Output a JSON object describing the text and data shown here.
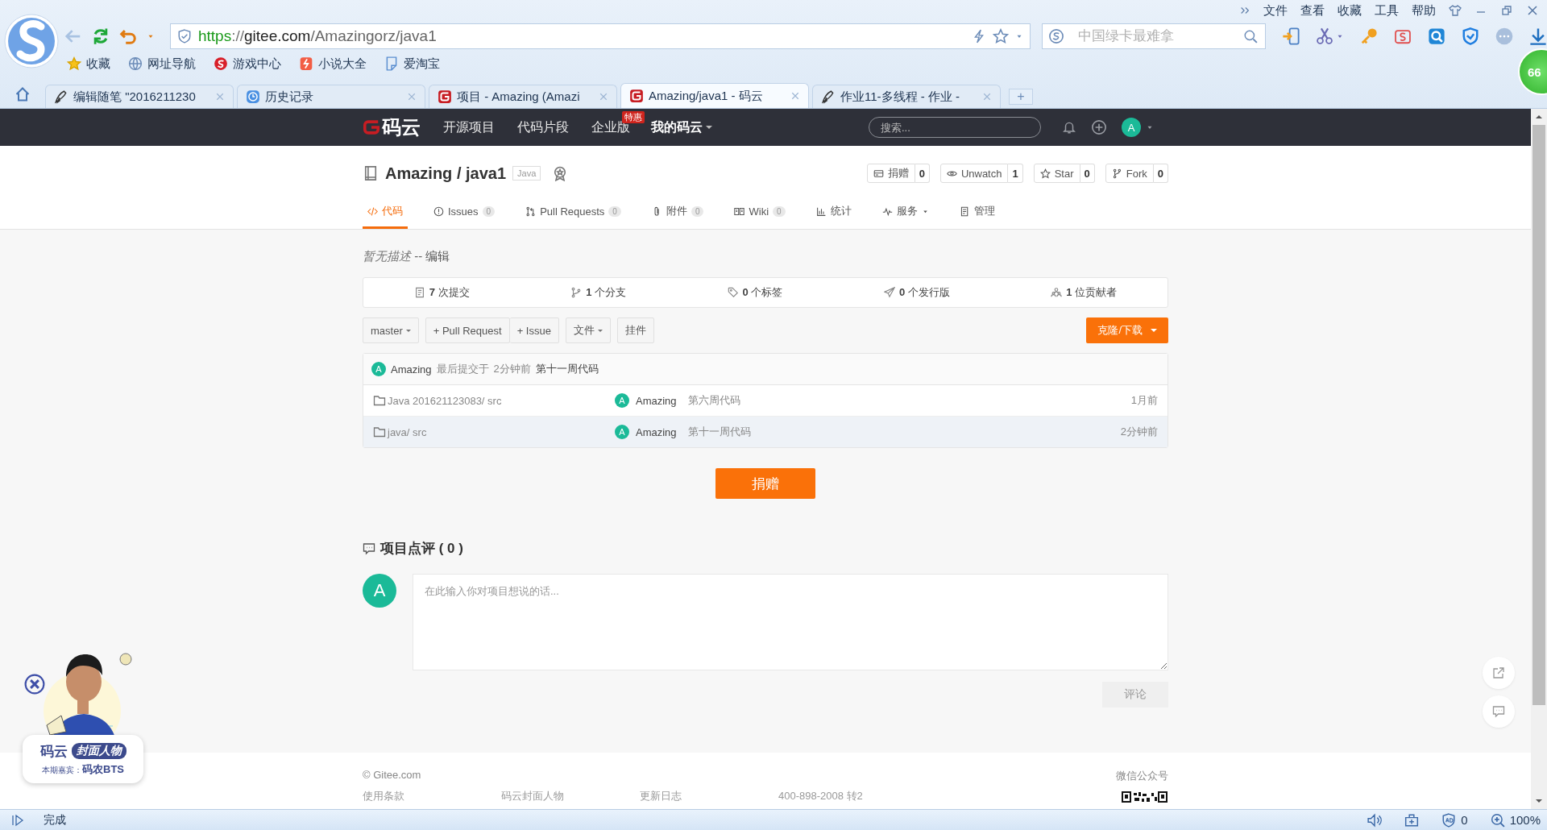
{
  "browser": {
    "menu": [
      "文件",
      "查看",
      "收藏",
      "工具",
      "帮助"
    ],
    "address": [
      {
        "kind": "scheme",
        "text": "https"
      },
      {
        "kind": "punct",
        "text": "://"
      },
      {
        "kind": "host",
        "text": "gitee.com"
      },
      {
        "kind": "path",
        "text": "/Amazingorz/java1"
      }
    ],
    "search": {
      "placeholder": "中国绿卡最难拿"
    },
    "bookmarks": [
      {
        "label": "收藏",
        "kind": "star"
      },
      {
        "label": "网址导航",
        "kind": "globe"
      },
      {
        "label": "游戏中心",
        "kind": "game"
      },
      {
        "label": "小说大全",
        "kind": "novel"
      },
      {
        "label": "爱淘宝",
        "kind": "page"
      }
    ],
    "tabs": [
      {
        "title": "编辑随笔 \"2016211230",
        "kind": "pen",
        "selected": false
      },
      {
        "title": "历史记录",
        "kind": "clock",
        "selected": false
      },
      {
        "title": "项目 - Amazing (Amazi",
        "kind": "gitee",
        "selected": false
      },
      {
        "title": "Amazing/java1 - 码云",
        "kind": "gitee",
        "selected": true
      },
      {
        "title": "作业11-多线程 - 作业 -",
        "kind": "pen",
        "selected": false
      }
    ],
    "new_tab": "+",
    "speed_ball": "66"
  },
  "navbar": {
    "logo": "码云",
    "items": [
      {
        "label": "开源项目"
      },
      {
        "label": "代码片段"
      },
      {
        "label": "企业版",
        "badge": "特惠"
      },
      {
        "label": "我的码云",
        "dropdown": true
      }
    ],
    "search": {
      "placeholder": "搜索..."
    },
    "avatar": "A"
  },
  "repo": {
    "title": "Amazing / java1",
    "language": "Java",
    "actions": [
      {
        "kind": "donate",
        "label": "捐赠",
        "count": "0"
      },
      {
        "kind": "watch",
        "label": "Unwatch",
        "count": "1"
      },
      {
        "kind": "star",
        "label": "Star",
        "count": "0"
      },
      {
        "kind": "fork",
        "label": "Fork",
        "count": "0"
      }
    ],
    "tabs": [
      {
        "kind": "code",
        "label": "代码",
        "selected": true
      },
      {
        "kind": "issues",
        "label": "Issues",
        "count": "0",
        "selected": false
      },
      {
        "kind": "pr",
        "label": "Pull Requests",
        "count": "0",
        "selected": false
      },
      {
        "kind": "attach",
        "label": "附件",
        "count": "0",
        "selected": false
      },
      {
        "kind": "wiki",
        "label": "Wiki",
        "count": "0",
        "selected": false
      },
      {
        "kind": "stats",
        "label": "统计",
        "selected": false
      },
      {
        "kind": "service",
        "label": "服务",
        "dropdown": true,
        "selected": false
      },
      {
        "kind": "manage",
        "label": "管理",
        "selected": false
      }
    ]
  },
  "description": {
    "text": "暂无描述",
    "separator": "--",
    "link": "编辑"
  },
  "stats": [
    {
      "kind": "commits",
      "text": "**7** 次提交"
    },
    {
      "kind": "branches",
      "text": "**1** 个分支"
    },
    {
      "kind": "tags",
      "text": "**0** 个标签"
    },
    {
      "kind": "releases",
      "text": "**0** 个发行版"
    },
    {
      "kind": "contributors",
      "text": "**1** 位贡献者"
    }
  ],
  "toolbar": {
    "branch": "master",
    "buttons": [
      "+ Pull Request",
      "+ Issue"
    ],
    "file_menu": "文件",
    "widget": "挂件",
    "clone": "克隆/下载"
  },
  "last_commit": {
    "avatar": "A",
    "author": "Amazing",
    "action": "最后提交于",
    "time": "2分钟前",
    "message": "第十一周代码"
  },
  "files": [
    {
      "name": "Java 201621123083/ src",
      "avatar": "A",
      "author": "Amazing",
      "message": "第六周代码",
      "time": "1月前",
      "highlighted": false
    },
    {
      "name": "java/ src",
      "avatar": "A",
      "author": "Amazing",
      "message": "第十一周代码",
      "time": "2分钟前",
      "highlighted": true
    }
  ],
  "donate_button": "捐赠",
  "comments": {
    "title": "项目点评 ( 0 )",
    "avatar": "A",
    "placeholder": "在此输入你对项目想说的话...",
    "submit": "评论",
    "submit_disabled": true
  },
  "footer": {
    "copyright": "© Gitee.com",
    "links": [
      "使用条款",
      "码云封面人物",
      "更新日志",
      "400-898-2008 转2"
    ],
    "wechat_label": "微信公众号"
  },
  "cover_ad": {
    "brand": "码云",
    "title": "封面人物",
    "guest_label": "本期嘉宾：",
    "guest": "码农BTS"
  },
  "status_bar": {
    "text": "完成",
    "ad_count": "0",
    "zoom": "100%"
  }
}
